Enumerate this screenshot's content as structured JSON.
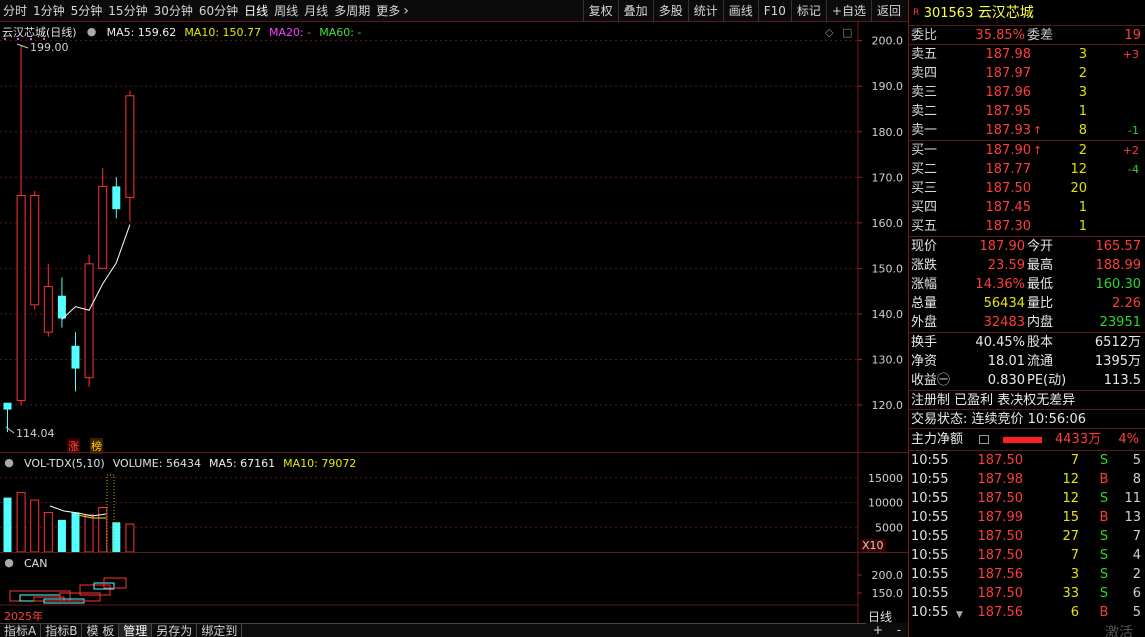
{
  "toolbar": {
    "periods": [
      "分时",
      "1分钟",
      "5分钟",
      "15分钟",
      "30分钟",
      "60分钟",
      "日线",
      "周线",
      "月线",
      "多周期",
      "更多"
    ],
    "active_period": "日线",
    "funcs": [
      "复权",
      "叠加",
      "多股",
      "统计",
      "画线",
      "F10",
      "标记",
      "+自选",
      "返回"
    ]
  },
  "chart": {
    "title": "云汉芯城(日线)",
    "ma5_label": "MA5: 159.62",
    "ma10_label": "MA10: 150.77",
    "ma20_label": "MA20: -",
    "ma60_label": "MA60: -",
    "high_mark": "199.00",
    "low_mark": "114.04",
    "tag_zhang": "涨",
    "tag_bang": "榜",
    "yaxis": [
      "200.0",
      "190.0",
      "180.0",
      "170.0",
      "160.0",
      "150.0",
      "140.0",
      "130.0",
      "120.0"
    ],
    "colors": {
      "up": "#ff3232",
      "down": "#54ffff",
      "ma5": "#ffffff"
    }
  },
  "chart_data": {
    "type": "candlestick",
    "ylim": [
      111,
      203
    ],
    "candles": [
      {
        "o": 119,
        "h": 120,
        "l": 114.04,
        "c": 120.5,
        "dir": "down"
      },
      {
        "o": 121,
        "h": 199,
        "l": 120,
        "c": 166,
        "dir": "up"
      },
      {
        "o": 166,
        "h": 167,
        "l": 141,
        "c": 142,
        "dir": "up"
      },
      {
        "o": 146,
        "h": 151,
        "l": 135,
        "c": 136,
        "dir": "up"
      },
      {
        "o": 144,
        "h": 148,
        "l": 137,
        "c": 139,
        "dir": "down"
      },
      {
        "o": 133,
        "h": 136,
        "l": 123,
        "c": 128,
        "dir": "down"
      },
      {
        "o": 126,
        "h": 153,
        "l": 124,
        "c": 151,
        "dir": "up"
      },
      {
        "o": 150,
        "h": 172,
        "l": 150,
        "c": 168,
        "dir": "up"
      },
      {
        "o": 168,
        "h": 170,
        "l": 161,
        "c": 163,
        "dir": "down"
      },
      {
        "o": 165.57,
        "h": 188.99,
        "l": 160.3,
        "c": 187.9,
        "dir": "up"
      }
    ],
    "ma5": [
      null,
      null,
      null,
      null,
      138.8,
      141.6,
      140.8,
      146.6,
      151.2,
      159.62
    ]
  },
  "volume": {
    "label": "VOL-TDX(5,10)",
    "value_label": "VOLUME: 56434",
    "ma5_label": "MA5: 67161",
    "ma10_label": "MA10: 79072",
    "yaxis": [
      "15000",
      "10000",
      "5000"
    ],
    "x10": "X10",
    "bars": [
      {
        "v": 11000,
        "dir": "down"
      },
      {
        "v": 12000,
        "dir": "up"
      },
      {
        "v": 10500,
        "dir": "up"
      },
      {
        "v": 8000,
        "dir": "up"
      },
      {
        "v": 6500,
        "dir": "down"
      },
      {
        "v": 8000,
        "dir": "down"
      },
      {
        "v": 7500,
        "dir": "up"
      },
      {
        "v": 9000,
        "dir": "up"
      },
      {
        "v": 6000,
        "dir": "down"
      },
      {
        "v": 5643,
        "dir": "up"
      }
    ]
  },
  "can": {
    "label": "CAN",
    "yaxis": [
      "200.0",
      "150.0"
    ],
    "year": "2025年",
    "period_btn": "日线"
  },
  "bottom_tabs": [
    "指标A",
    "指标B",
    "模 板",
    "管理",
    "另存为",
    "绑定到"
  ],
  "nav_arrows": [
    "+",
    "-"
  ],
  "quote": {
    "code": "301563",
    "name": "云汉芯城",
    "badge": "R",
    "weibi_label": "委比",
    "weibi": "35.85%",
    "weicha_label": "委差",
    "weicha": "19",
    "asks": [
      {
        "label": "卖五",
        "price": "187.98",
        "vol": "3",
        "chg": "+3",
        "arrow": ""
      },
      {
        "label": "卖四",
        "price": "187.97",
        "vol": "2",
        "chg": "",
        "arrow": ""
      },
      {
        "label": "卖三",
        "price": "187.96",
        "vol": "3",
        "chg": "",
        "arrow": ""
      },
      {
        "label": "卖二",
        "price": "187.95",
        "vol": "1",
        "chg": "",
        "arrow": ""
      },
      {
        "label": "卖一",
        "price": "187.93",
        "vol": "8",
        "chg": "-1",
        "arrow": "↑"
      }
    ],
    "bids": [
      {
        "label": "买一",
        "price": "187.90",
        "vol": "2",
        "chg": "+2",
        "arrow": "↑"
      },
      {
        "label": "买二",
        "price": "187.77",
        "vol": "12",
        "chg": "-4",
        "arrow": ""
      },
      {
        "label": "买三",
        "price": "187.50",
        "vol": "20",
        "chg": "",
        "arrow": ""
      },
      {
        "label": "买四",
        "price": "187.45",
        "vol": "1",
        "chg": "",
        "arrow": ""
      },
      {
        "label": "买五",
        "price": "187.30",
        "vol": "1",
        "chg": "",
        "arrow": ""
      }
    ],
    "stats1": [
      {
        "l1": "现价",
        "v1": "187.90",
        "c1": "red",
        "l2": "今开",
        "v2": "165.57",
        "c2": "red"
      },
      {
        "l1": "涨跌",
        "v1": "23.59",
        "c1": "red",
        "l2": "最高",
        "v2": "188.99",
        "c2": "red"
      },
      {
        "l1": "涨幅",
        "v1": "14.36%",
        "c1": "red",
        "l2": "最低",
        "v2": "160.30",
        "c2": "green"
      },
      {
        "l1": "总量",
        "v1": "56434",
        "c1": "yellow",
        "l2": "量比",
        "v2": "2.26",
        "c2": "red"
      },
      {
        "l1": "外盘",
        "v1": "32483",
        "c1": "red",
        "l2": "内盘",
        "v2": "23951",
        "c2": "green"
      }
    ],
    "stats2": [
      {
        "l1": "换手",
        "v1": "40.45%",
        "l2": "股本",
        "v2": "6512万"
      },
      {
        "l1": "净资",
        "v1": "18.01",
        "l2": "流通",
        "v2": "1395万"
      },
      {
        "l1": "收益㊀",
        "v1": "0.830",
        "l2": "PE(动)",
        "v2": "113.5"
      }
    ],
    "tags": "注册制 已盈利 表决权无差异",
    "trade_status": "交易状态: 连续竞价 10:56:06",
    "main_flow_label": "主力净额",
    "main_flow_value": "4433万",
    "main_flow_pct": "4%",
    "main_flow_fill": 0.3,
    "ticks": [
      {
        "t": "10:55",
        "p": "187.50",
        "v": "7",
        "d": "S",
        "n": "5"
      },
      {
        "t": "10:55",
        "p": "187.98",
        "v": "12",
        "d": "B",
        "n": "8"
      },
      {
        "t": "10:55",
        "p": "187.50",
        "v": "12",
        "d": "S",
        "n": "11"
      },
      {
        "t": "10:55",
        "p": "187.99",
        "v": "15",
        "d": "B",
        "n": "13"
      },
      {
        "t": "10:55",
        "p": "187.50",
        "v": "27",
        "d": "S",
        "n": "7"
      },
      {
        "t": "10:55",
        "p": "187.50",
        "v": "7",
        "d": "S",
        "n": "4"
      },
      {
        "t": "10:55",
        "p": "187.56",
        "v": "3",
        "d": "S",
        "n": "2"
      },
      {
        "t": "10:55",
        "p": "187.50",
        "v": "33",
        "d": "S",
        "n": "6"
      },
      {
        "t": "10:55",
        "p": "187.56",
        "v": "6",
        "d": "B",
        "n": "5"
      }
    ],
    "watermark": "激活"
  }
}
